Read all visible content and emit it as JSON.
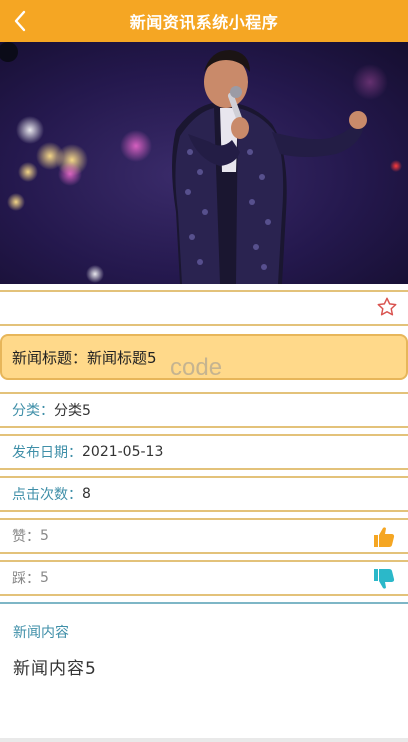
{
  "navbar": {
    "back_icon": "chevron-left-icon",
    "title": "新闻资讯系统小程序",
    "background": "#f5a623"
  },
  "hero": {
    "description_icon": "news-photo"
  },
  "favorite": {
    "icon": "star-outline-icon",
    "color": "#d9534f"
  },
  "title_card": {
    "label": "新闻标题：",
    "value": "新闻标题5"
  },
  "watermark": "code",
  "fields": {
    "category": {
      "label": "分类：",
      "value": "分类5"
    },
    "publish_date": {
      "label": "发布日期：",
      "value": "2021-05-13"
    },
    "click_count": {
      "label": "点击次数：",
      "value": "8"
    },
    "likes": {
      "label": "赞：",
      "value": "5",
      "icon": "thumbs-up-icon",
      "color": "#f5a623"
    },
    "dislikes": {
      "label": "踩：",
      "value": "5",
      "icon": "thumbs-down-icon",
      "color": "#2bb8c9"
    }
  },
  "content": {
    "heading": "新闻内容",
    "body": "新闻内容5"
  }
}
